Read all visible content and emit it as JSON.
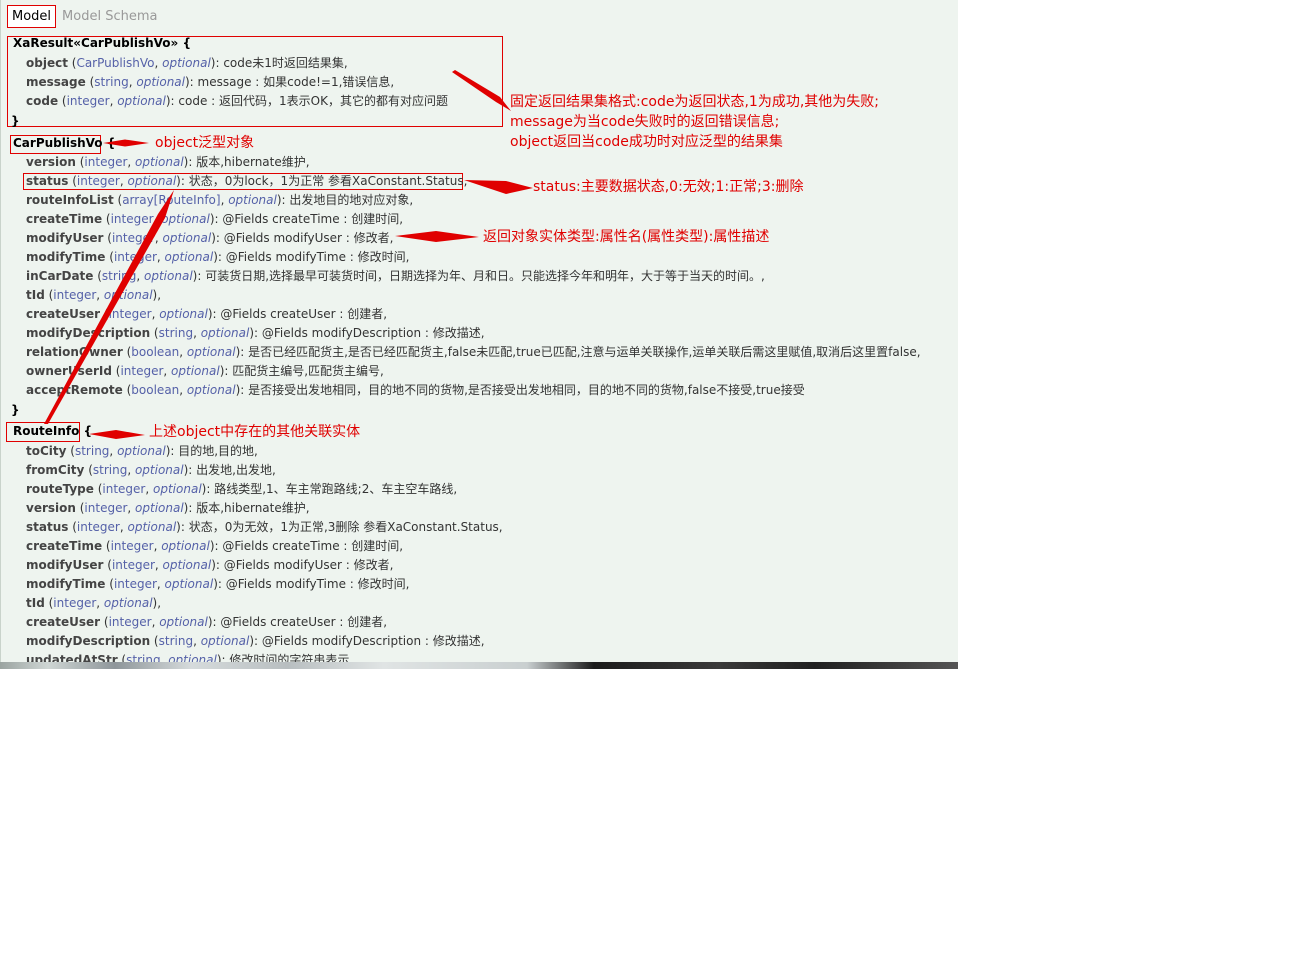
{
  "tabs": {
    "model": "Model",
    "schema": "Model Schema"
  },
  "xaresult": {
    "title": "XaResult«CarPublishVo» {",
    "close": "}",
    "props": [
      {
        "name": "object",
        "open": " (",
        "type": "CarPublishVo",
        "sep": ", ",
        "opt": "optional",
        "desc": "): code未1时返回结果集,"
      },
      {
        "name": "message",
        "open": " (",
        "type": "string",
        "sep": ", ",
        "opt": "optional",
        "desc": "): message : 如果code!=1,错误信息,"
      },
      {
        "name": "code",
        "open": " (",
        "type": "integer",
        "sep": ", ",
        "opt": "optional",
        "desc": "): code : 返回代码，1表示OK，其它的都有对应问题"
      }
    ]
  },
  "carpublish": {
    "title": "CarPublishVo",
    "open": " {",
    "close": "}",
    "props": [
      {
        "name": "version",
        "open": " (",
        "type": "integer",
        "sep": ", ",
        "opt": "optional",
        "desc": "): 版本,hibernate维护,"
      },
      {
        "name": "status",
        "open": " (",
        "type": "integer",
        "sep": ", ",
        "opt": "optional",
        "desc": "): 状态，0为lock，1为正常 参看XaConstant.Status,"
      },
      {
        "name": "routeInfoList",
        "open": " (",
        "type": "array[RouteInfo]",
        "sep": ", ",
        "opt": "optional",
        "desc": "): 出发地目的地对应对象,"
      },
      {
        "name": "createTime",
        "open": " (",
        "type": "integer",
        "sep": ", ",
        "opt": "optional",
        "desc": "): @Fields createTime : 创建时间,"
      },
      {
        "name": "modifyUser",
        "open": " (",
        "type": "integer",
        "sep": ", ",
        "opt": "optional",
        "desc": "): @Fields modifyUser : 修改者,"
      },
      {
        "name": "modifyTime",
        "open": " (",
        "type": "integer",
        "sep": ", ",
        "opt": "optional",
        "desc": "): @Fields modifyTime : 修改时间,"
      },
      {
        "name": "inCarDate",
        "open": " (",
        "type": "string",
        "sep": ", ",
        "opt": "optional",
        "desc": "): 可装货日期,选择最早可装货时间，日期选择为年、月和日。只能选择今年和明年，大于等于当天的时间。,"
      },
      {
        "name": "tId",
        "open": " (",
        "type": "integer",
        "sep": ", ",
        "opt": "optional",
        "desc": "),"
      },
      {
        "name": "createUser",
        "open": " (",
        "type": "integer",
        "sep": ", ",
        "opt": "optional",
        "desc": "): @Fields createUser : 创建者,"
      },
      {
        "name": "modifyDescription",
        "open": " (",
        "type": "string",
        "sep": ", ",
        "opt": "optional",
        "desc": "): @Fields modifyDescription : 修改描述,"
      },
      {
        "name": "relationOwner",
        "open": " (",
        "type": "boolean",
        "sep": ", ",
        "opt": "optional",
        "desc": "): 是否已经匹配货主,是否已经匹配货主,false未匹配,true已匹配,注意与运单关联操作,运单关联后需这里赋值,取消后这里置false,"
      },
      {
        "name": "ownerUserId",
        "open": " (",
        "type": "integer",
        "sep": ", ",
        "opt": "optional",
        "desc": "): 匹配货主编号,匹配货主编号,"
      },
      {
        "name": "acceptRemote",
        "open": " (",
        "type": "boolean",
        "sep": ", ",
        "opt": "optional",
        "desc": "): 是否接受出发地相同，目的地不同的货物,是否接受出发地相同，目的地不同的货物,false不接受,true接受"
      }
    ]
  },
  "routeinfo": {
    "title": "RouteInfo",
    "open": " {",
    "props": [
      {
        "name": "toCity",
        "open": " (",
        "type": "string",
        "sep": ", ",
        "opt": "optional",
        "desc": "): 目的地,目的地,"
      },
      {
        "name": "fromCity",
        "open": " (",
        "type": "string",
        "sep": ", ",
        "opt": "optional",
        "desc": "): 出发地,出发地,"
      },
      {
        "name": "routeType",
        "open": " (",
        "type": "integer",
        "sep": ", ",
        "opt": "optional",
        "desc": "): 路线类型,1、车主常跑路线;2、车主空车路线,"
      },
      {
        "name": "version",
        "open": " (",
        "type": "integer",
        "sep": ", ",
        "opt": "optional",
        "desc": "): 版本,hibernate维护,"
      },
      {
        "name": "status",
        "open": " (",
        "type": "integer",
        "sep": ", ",
        "opt": "optional",
        "desc": "): 状态，0为无效，1为正常,3删除 参看XaConstant.Status,"
      },
      {
        "name": "createTime",
        "open": " (",
        "type": "integer",
        "sep": ", ",
        "opt": "optional",
        "desc": "): @Fields createTime : 创建时间,"
      },
      {
        "name": "modifyUser",
        "open": " (",
        "type": "integer",
        "sep": ", ",
        "opt": "optional",
        "desc": "): @Fields modifyUser : 修改者,"
      },
      {
        "name": "modifyTime",
        "open": " (",
        "type": "integer",
        "sep": ", ",
        "opt": "optional",
        "desc": "): @Fields modifyTime : 修改时间,"
      },
      {
        "name": "tId",
        "open": " (",
        "type": "integer",
        "sep": ", ",
        "opt": "optional",
        "desc": "),"
      },
      {
        "name": "createUser",
        "open": " (",
        "type": "integer",
        "sep": ", ",
        "opt": "optional",
        "desc": "): @Fields createUser : 创建者,"
      },
      {
        "name": "modifyDescription",
        "open": " (",
        "type": "string",
        "sep": ", ",
        "opt": "optional",
        "desc": "): @Fields modifyDescription : 修改描述,"
      },
      {
        "name": "updatedAtStr",
        "open": " (",
        "type": "string",
        "sep": ", ",
        "opt": "optional",
        "desc": "): 修改时间的字符串表示"
      }
    ]
  },
  "annotations": {
    "result_format_1": "固定返回结果集格式:code为返回状态,1为成功,其他为失败;",
    "result_format_2": "message为当code失败时的返回错误信息;",
    "result_format_3": "object返回当code成功时对应泛型的结果集",
    "generic_object": "object泛型对象",
    "status_note": "status:主要数据状态,0:无效;1:正常;3:删除",
    "entity_format": "返回对象实体类型:属性名(属性类型):属性描述",
    "related_entities": "上述object中存在的其他关联实体"
  },
  "colors": {
    "annotation": "#e00000",
    "panel_bg": "#eef4ef",
    "type_text": "#5561a8"
  }
}
